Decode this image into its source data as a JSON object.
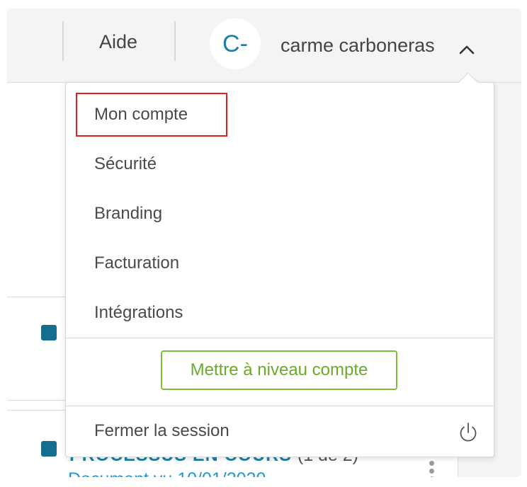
{
  "header": {
    "help_label": "Aide",
    "avatar_initials": "C-",
    "user_name": "carme carboneras"
  },
  "user_menu": {
    "items": [
      {
        "label": "Mon compte"
      },
      {
        "label": "Sécurité"
      },
      {
        "label": "Branding"
      },
      {
        "label": "Facturation"
      },
      {
        "label": "Intégrations"
      }
    ],
    "upgrade_label": "Mettre à niveau compte",
    "logout_label": "Fermer la session"
  },
  "background": {
    "process_title": "PROCESSUS EN COURS",
    "process_count": "(1 de 2)",
    "document_viewed": "Document vu 10/01/2020"
  },
  "colors": {
    "accent": "#1e7fa4",
    "upgrade_green": "#7cbd3a",
    "highlight_red": "#e02020",
    "status_square": "#146e8e"
  },
  "icons": {
    "chevron": "chevron-up-icon",
    "power": "power-icon",
    "kebab": "kebab-menu-icon"
  }
}
